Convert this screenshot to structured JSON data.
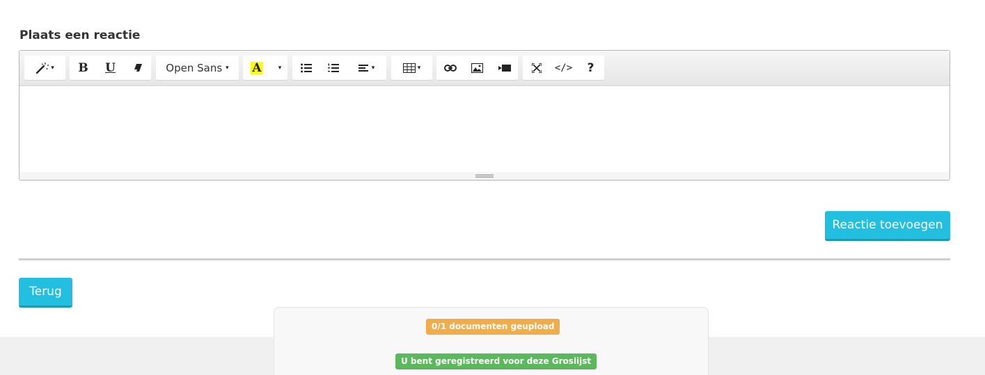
{
  "heading": "Plaats een reactie",
  "toolbar": {
    "font_name": "Open Sans",
    "bold_label": "B",
    "underline_label": "U",
    "highlight_label": "A",
    "code_label": "</>",
    "help_label": "?",
    "caret": "▾",
    "icons": [
      "magic-wand-icon",
      "eraser-icon",
      "unordered-list-icon",
      "ordered-list-icon",
      "align-icon",
      "table-icon",
      "link-icon",
      "picture-icon",
      "video-icon",
      "fullscreen-icon"
    ]
  },
  "actions": {
    "add_comment": "Reactie toevoegen",
    "back": "Terug"
  },
  "status": {
    "documents": "0/1 documenten geupload",
    "registered": "U bent geregistreerd voor deze Groslijst"
  },
  "colors": {
    "primary_button": "#22bfe0",
    "badge_warning": "#f0ad4e",
    "badge_success": "#5cb85c",
    "highlight": "#ffff00"
  }
}
